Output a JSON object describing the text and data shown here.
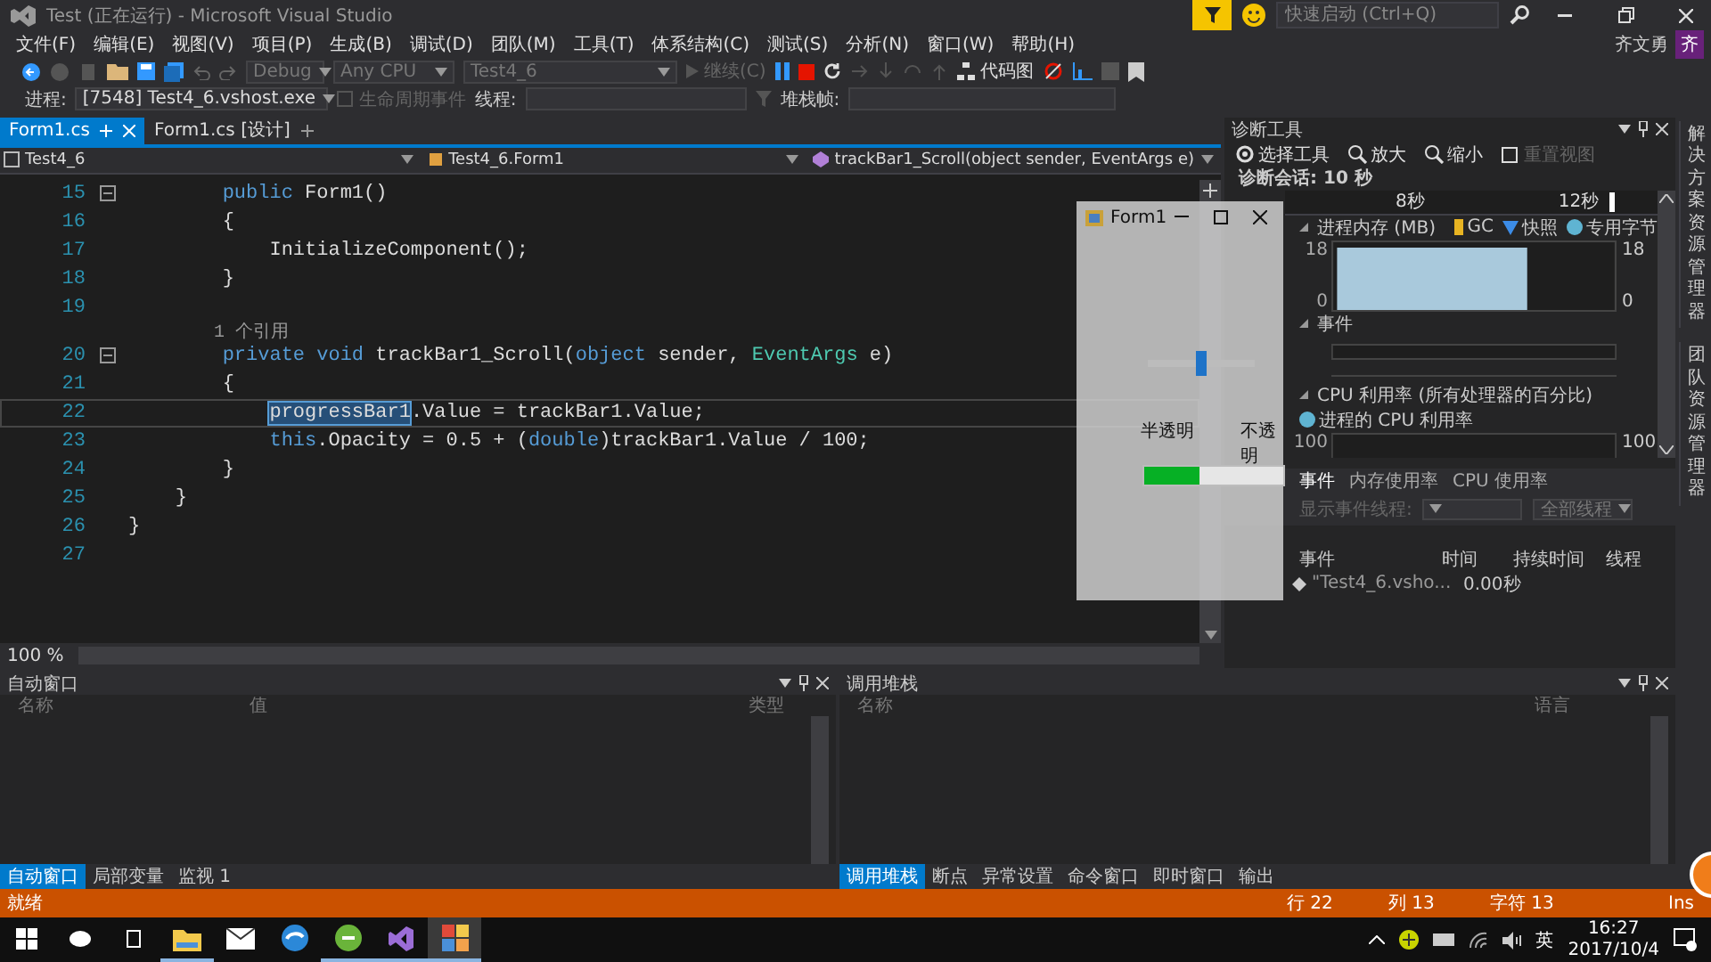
{
  "window": {
    "title": "Test (正在运行) - Microsoft Visual Studio",
    "quick_launch_placeholder": "快速启动 (Ctrl+Q)",
    "user": "齐文勇",
    "avatar": "齐"
  },
  "menu": [
    "文件(F)",
    "编辑(E)",
    "视图(V)",
    "项目(P)",
    "生成(B)",
    "调试(D)",
    "团队(M)",
    "工具(T)",
    "体系结构(C)",
    "测试(S)",
    "分析(N)",
    "窗口(W)",
    "帮助(H)"
  ],
  "toolbar": {
    "configuration": "Debug",
    "platform": "Any CPU",
    "startup_project": "Test4_6",
    "continue": {
      "label": "继续(C)",
      "disabled": true
    },
    "code_map": "代码图"
  },
  "debug_location": {
    "process_label": "进程:",
    "process": "[7548] Test4_6.vshost.exe",
    "lifecycle_events": {
      "label": "生命周期事件",
      "disabled": true
    },
    "thread_label": "线程:",
    "stack_frame_label": "堆栈帧:"
  },
  "editor": {
    "tabs": [
      {
        "label": "Form1.cs",
        "selected": true
      },
      {
        "label": "Form1.cs [设计]",
        "selected": false
      }
    ],
    "navigation": [
      "Test4_6",
      "Test4_6.Form1",
      "trackBar1_Scroll(object sender, EventArgs e)"
    ],
    "lines": [
      {
        "kind": "code",
        "number": "15",
        "collapsible": true,
        "current": false,
        "tokens": [
          {
            "text": "        public",
            "kind": "keyword"
          },
          {
            "text": " Form1()",
            "kind": "plain"
          }
        ]
      },
      {
        "kind": "code",
        "number": "16",
        "collapsible": false,
        "current": false,
        "tokens": [
          {
            "text": "        {",
            "kind": "plain"
          }
        ]
      },
      {
        "kind": "code",
        "number": "17",
        "collapsible": false,
        "current": false,
        "tokens": [
          {
            "text": "            InitializeComponent();",
            "kind": "plain"
          }
        ]
      },
      {
        "kind": "code",
        "number": "18",
        "collapsible": false,
        "current": false,
        "tokens": [
          {
            "text": "        }",
            "kind": "plain"
          }
        ]
      },
      {
        "kind": "code",
        "number": "19",
        "collapsible": false,
        "current": false
      },
      {
        "kind": "lens",
        "text": "        1 个引用"
      },
      {
        "kind": "code",
        "number": "20",
        "collapsible": true,
        "current": false,
        "tokens": [
          {
            "text": "        private void",
            "kind": "keyword"
          },
          {
            "text": " trackBar1_Scroll(",
            "kind": "plain"
          },
          {
            "text": "object",
            "kind": "keyword"
          },
          {
            "text": " sender, ",
            "kind": "plain"
          },
          {
            "text": "EventArgs",
            "kind": "type"
          },
          {
            "text": " e)",
            "kind": "plain"
          }
        ]
      },
      {
        "kind": "code",
        "number": "21",
        "collapsible": false,
        "current": false,
        "tokens": [
          {
            "text": "        {",
            "kind": "plain"
          }
        ]
      },
      {
        "kind": "code",
        "number": "22",
        "collapsible": false,
        "current": true,
        "tokens": [
          {
            "text": "            progressBar1",
            "kind": "selection"
          },
          {
            "text": ".Value = trackBar1.Value;",
            "kind": "plain"
          }
        ]
      },
      {
        "kind": "code",
        "number": "23",
        "collapsible": false,
        "current": false,
        "tokens": [
          {
            "text": "            this",
            "kind": "keyword"
          },
          {
            "text": ".Opacity = 0.5 + (",
            "kind": "plain"
          },
          {
            "text": "double",
            "kind": "keyword"
          },
          {
            "text": ")trackBar1.Value / 100;",
            "kind": "plain"
          }
        ]
      },
      {
        "kind": "code",
        "number": "24",
        "collapsible": false,
        "current": false,
        "tokens": [
          {
            "text": "        }",
            "kind": "plain"
          }
        ]
      },
      {
        "kind": "code",
        "number": "25",
        "collapsible": false,
        "current": false,
        "tokens": [
          {
            "text": "    }",
            "kind": "plain"
          }
        ]
      },
      {
        "kind": "code",
        "number": "26",
        "collapsible": false,
        "current": false,
        "tokens": [
          {
            "text": "}",
            "kind": "plain"
          }
        ]
      },
      {
        "kind": "code",
        "number": "27",
        "collapsible": false,
        "current": false
      }
    ],
    "zoom": "100 %"
  },
  "form_window": {
    "title": "Form1",
    "trackbar": {
      "level": 0.5
    },
    "min_label": "半透明",
    "max_label": "不透明",
    "progress": {
      "level": 0.4
    }
  },
  "diagnostics": {
    "title": "诊断工具",
    "tools": [
      {
        "label": "选择工具",
        "kind": "select",
        "disabled": false
      },
      {
        "label": "放大",
        "kind": "zoom_in",
        "disabled": false
      },
      {
        "label": "缩小",
        "kind": "zoom_out",
        "disabled": false
      },
      {
        "label": "重置视图",
        "kind": "reset",
        "disabled": true
      }
    ],
    "session": "诊断会话: 10 秒",
    "timeline": [
      "8秒",
      "12秒"
    ],
    "memory": {
      "title": "进程内存 (MB)",
      "legend": [
        {
          "label": "GC",
          "kind": "marker",
          "color": "#e8b422"
        },
        {
          "label": "快照",
          "kind": "triangle",
          "color": "#3c8ce6"
        },
        {
          "label": "专用字节",
          "kind": "dot",
          "color": "#5fb4d2"
        }
      ],
      "axis_max": "18",
      "axis_min": "0",
      "right_max": "18",
      "right_min": "0"
    },
    "events": {
      "title": "事件"
    },
    "cpu": {
      "title": "CPU 利用率 (所有处理器的百分比)",
      "legend": {
        "label": "进程的 CPU 利用率",
        "color": "#5fb4d2"
      },
      "axis_max": "100",
      "right_max": "100"
    },
    "tabs": [
      {
        "label": "事件",
        "selected": true
      },
      {
        "label": "内存使用率",
        "selected": false
      },
      {
        "label": "CPU 使用率",
        "selected": false
      }
    ],
    "filter_label": "显示事件线程:",
    "thread_filter": "全部线程",
    "columns": [
      "事件",
      "时间",
      "持续时间",
      "线程"
    ],
    "rows": [
      {
        "event": "\"Test4_6.vsho...",
        "time": "0.00秒"
      }
    ]
  },
  "autos": {
    "title": "自动窗口",
    "columns": [
      "名称",
      "值",
      "类型"
    ],
    "tabs": [
      {
        "label": "自动窗口",
        "selected": true
      },
      {
        "label": "局部变量",
        "selected": false
      },
      {
        "label": "监视 1",
        "selected": false
      }
    ]
  },
  "call_stack": {
    "title": "调用堆栈",
    "columns": [
      "名称",
      "语言"
    ],
    "tabs": [
      {
        "label": "调用堆栈",
        "selected": true
      },
      {
        "label": "断点",
        "selected": false
      },
      {
        "label": "异常设置",
        "selected": false
      },
      {
        "label": "命令窗口",
        "selected": false
      },
      {
        "label": "即时窗口",
        "selected": false
      },
      {
        "label": "输出",
        "selected": false
      }
    ]
  },
  "side_tabs": [
    "解决方案资源管理器",
    "团队资源管理器"
  ],
  "status_bar": {
    "message": "就绪",
    "line": "行 22",
    "column": "列 13",
    "char": "字符 13",
    "mode": "Ins"
  },
  "taskbar": {
    "apps": [
      {
        "kind": "explorer",
        "running": true,
        "selected": false
      },
      {
        "kind": "mail",
        "running": false,
        "selected": false
      },
      {
        "kind": "browser",
        "running": false,
        "selected": false
      },
      {
        "kind": "green",
        "running": true,
        "selected": false
      },
      {
        "kind": "studio",
        "running": true,
        "selected": false
      },
      {
        "kind": "form",
        "running": true,
        "selected": true
      }
    ],
    "ime": "英",
    "time": "16:27",
    "date": "2017/10/4"
  }
}
